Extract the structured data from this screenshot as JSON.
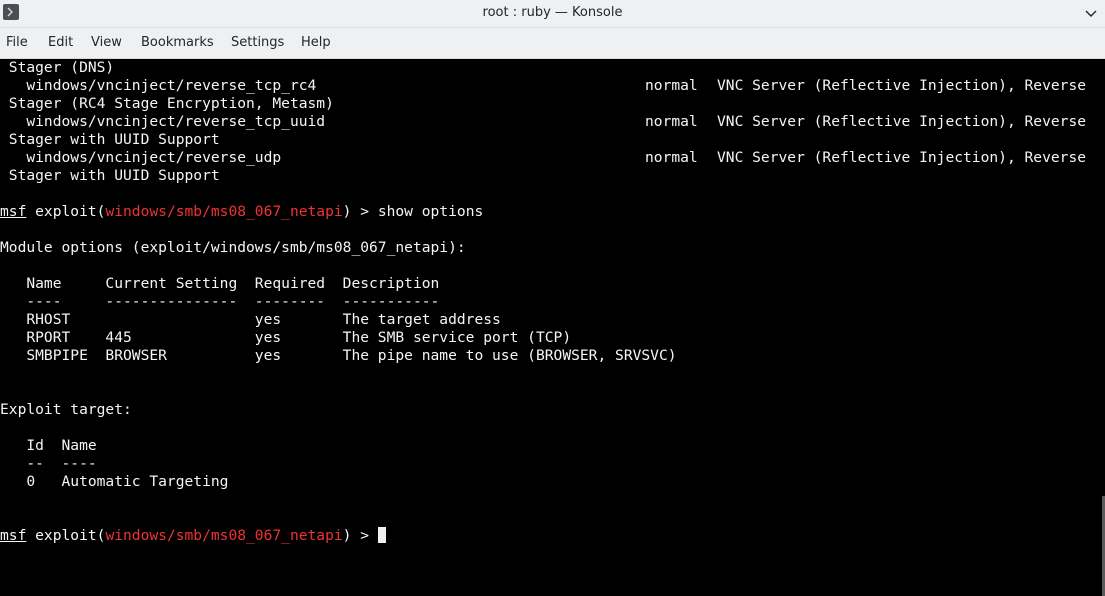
{
  "window": {
    "title": "root : ruby — Konsole",
    "menu_icon": "chevron-down-icon",
    "app_icon": "terminal-icon"
  },
  "menubar": {
    "items": [
      "File",
      "Edit",
      "View",
      "Bookmarks",
      "Settings",
      "Help"
    ]
  },
  "terminal": {
    "payload_rows": [
      {
        "col1": " Stager (DNS)"
      },
      {
        "col1": "   windows/vncinject/reverse_tcp_rc4",
        "rank": "normal",
        "desc": "VNC Server (Reflective Injection), Reverse"
      },
      {
        "col1": " Stager (RC4 Stage Encryption, Metasm)"
      },
      {
        "col1": "   windows/vncinject/reverse_tcp_uuid",
        "rank": "normal",
        "desc": "VNC Server (Reflective Injection), Reverse"
      },
      {
        "col1": " Stager with UUID Support"
      },
      {
        "col1": "   windows/vncinject/reverse_udp",
        "rank": "normal",
        "desc": "VNC Server (Reflective Injection), Reverse"
      },
      {
        "col1": " Stager with UUID Support"
      }
    ],
    "prompt": {
      "msf": "msf",
      "exploit_word": " exploit(",
      "module": "windows/smb/ms08_067_netapi",
      "close": ") > ",
      "command": "show options"
    },
    "module_options_header": "Module options (exploit/windows/smb/ms08_067_netapi):",
    "options_table": {
      "header": "   Name     Current Setting  Required  Description",
      "divider": "   ----     ---------------  --------  -----------",
      "rows": [
        "   RHOST                     yes       The target address",
        "   RPORT    445              yes       The SMB service port (TCP)",
        "   SMBPIPE  BROWSER          yes       The pipe name to use (BROWSER, SRVSVC)"
      ]
    },
    "exploit_target_header": "Exploit target:",
    "target_table": {
      "header": "   Id  Name",
      "divider": "   --  ----",
      "rows": [
        "   0   Automatic Targeting"
      ]
    },
    "final_prompt": {
      "msf": "msf",
      "exploit_word": " exploit(",
      "module": "windows/smb/ms08_067_netapi",
      "close": ") > "
    }
  }
}
